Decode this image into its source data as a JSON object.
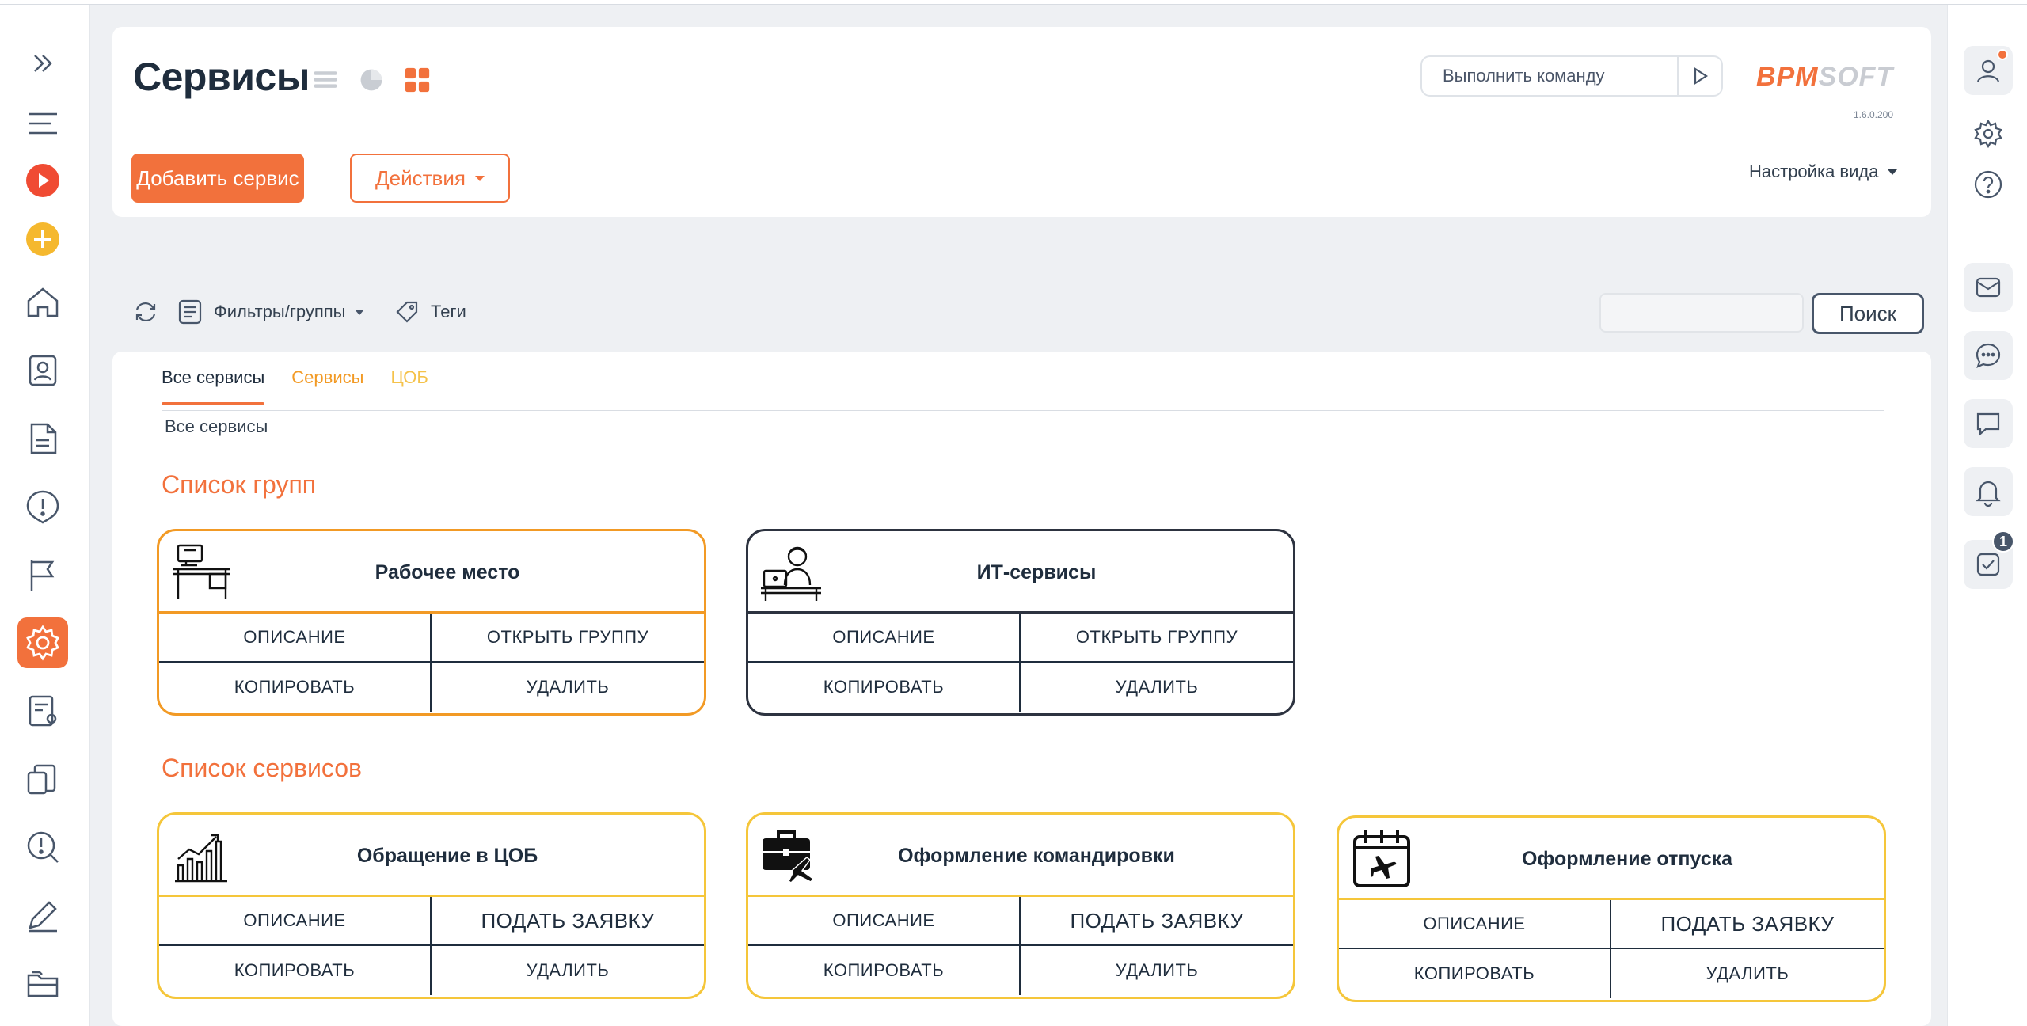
{
  "app": {
    "page_title": "Сервисы",
    "brand_part1": "BPM",
    "brand_part2": "SOFT",
    "version": "1.6.0.200",
    "accent_color": "#f2713c"
  },
  "header": {
    "command_placeholder": "Выполнить команду",
    "add_button": "Добавить сервис",
    "actions_button": "Действия",
    "view_settings": "Настройка вида"
  },
  "filters": {
    "filters_groups": "Фильтры/группы",
    "tags": "Теги",
    "search_button": "Поиск",
    "search_value": ""
  },
  "tabs": [
    {
      "label": "Все сервисы"
    },
    {
      "label": "Сервисы"
    },
    {
      "label": "ЦОБ"
    }
  ],
  "breadcrumb": "Все сервисы",
  "sections": {
    "groups_title": "Список групп",
    "services_title": "Список сервисов"
  },
  "groups": [
    {
      "title": "Рабочее место",
      "icon": "desk-icon",
      "actions": [
        "ОПИСАНИЕ",
        "ОТКРЫТЬ ГРУППУ",
        "КОПИРОВАТЬ",
        "УДАЛИТЬ"
      ]
    },
    {
      "title": "ИТ-сервисы",
      "icon": "it-specialist-icon",
      "actions": [
        "ОПИСАНИЕ",
        "ОТКРЫТЬ ГРУППУ",
        "КОПИРОВАТЬ",
        "УДАЛИТЬ"
      ]
    }
  ],
  "services": [
    {
      "title": "Обращение в ЦОБ",
      "icon": "growth-chart-icon",
      "actions": [
        "ОПИСАНИЕ",
        "ПОДАТЬ ЗАЯВКУ",
        "КОПИРОВАТЬ",
        "УДАЛИТЬ"
      ]
    },
    {
      "title": "Оформление командировки",
      "icon": "briefcase-plane-icon",
      "actions": [
        "ОПИСАНИЕ",
        "ПОДАТЬ ЗАЯВКУ",
        "КОПИРОВАТЬ",
        "УДАЛИТЬ"
      ]
    },
    {
      "title": "Оформление отпуска",
      "icon": "calendar-plane-icon",
      "actions": [
        "ОПИСАНИЕ",
        "ПОДАТЬ ЗАЯВКУ",
        "КОПИРОВАТЬ",
        "УДАЛИТЬ"
      ]
    }
  ],
  "right_sidebar": {
    "tasks_badge": "1"
  }
}
